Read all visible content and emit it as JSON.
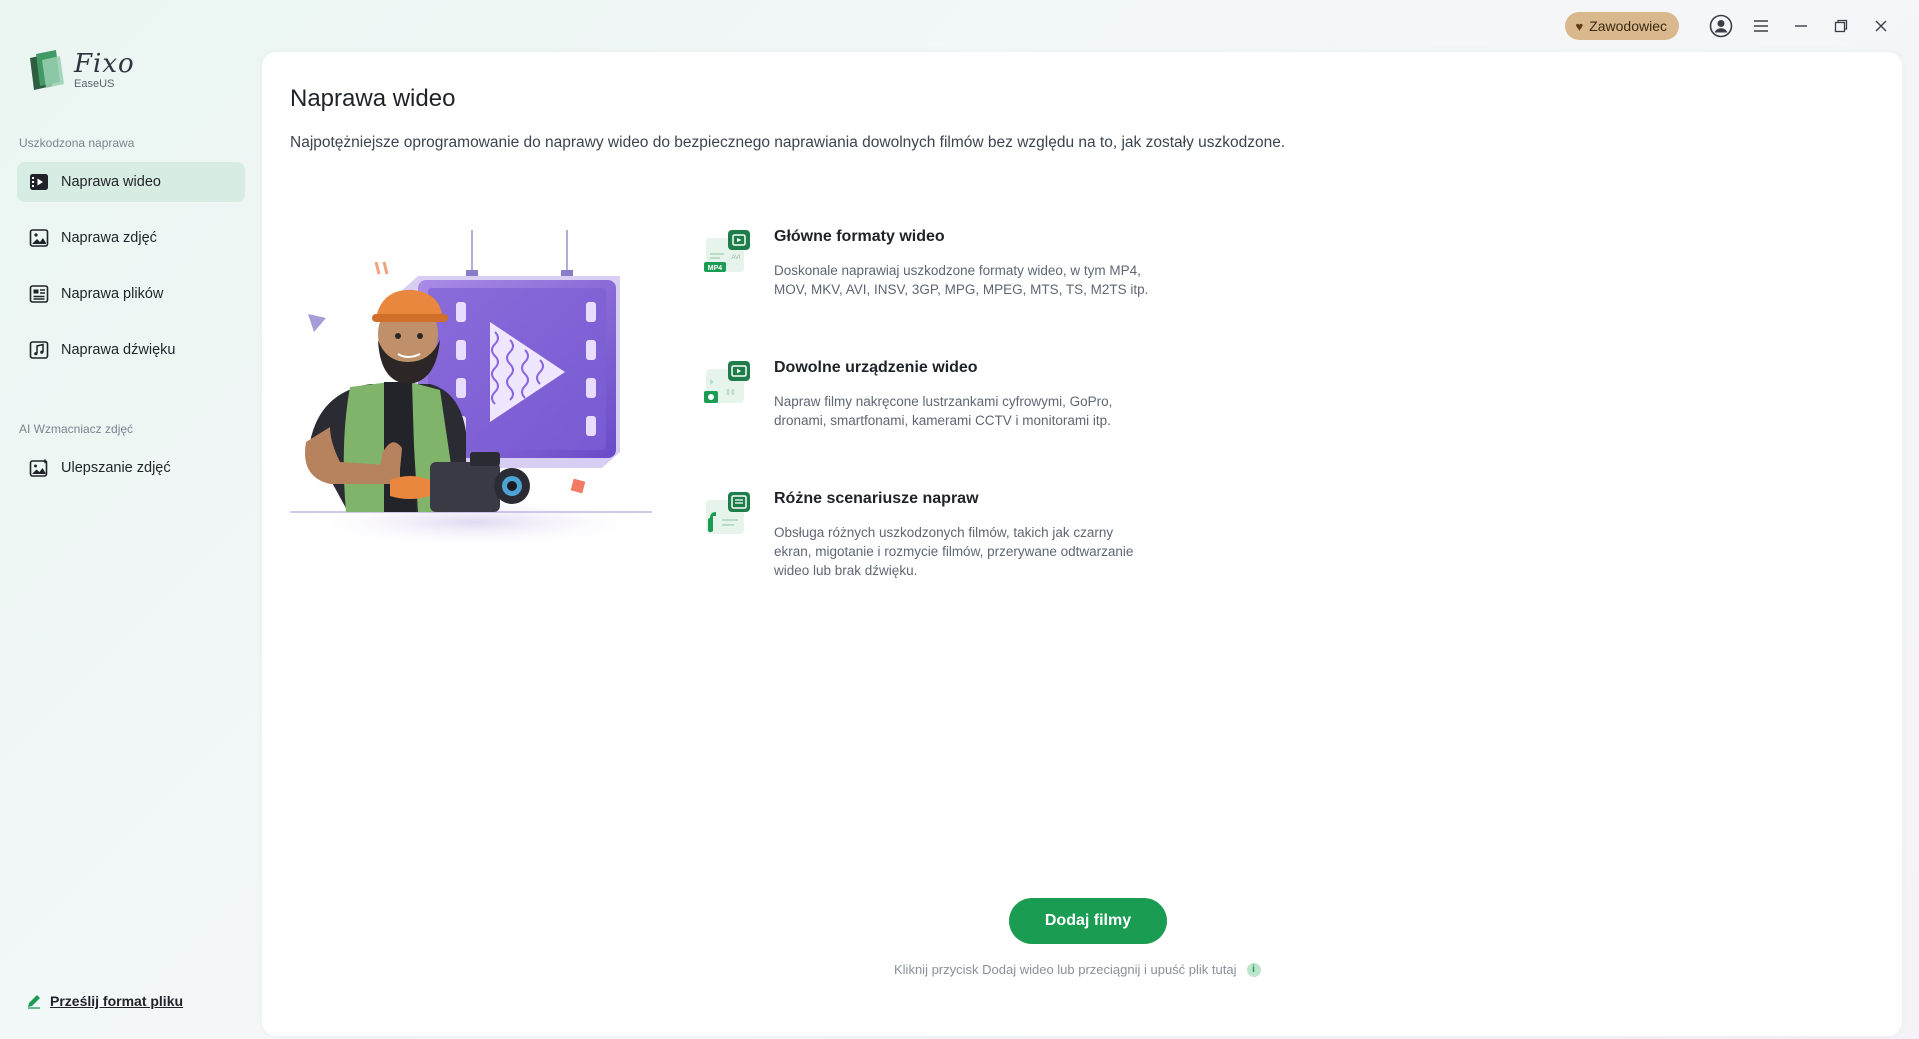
{
  "app": {
    "logo_name": "Fixo",
    "logo_sub": "EaseUS",
    "plan_badge": "Zawodowiec"
  },
  "sidebar": {
    "section1_label": "Uszkodzona naprawa",
    "items": [
      {
        "label": "Naprawa wideo",
        "icon": "video-icon",
        "active": true
      },
      {
        "label": "Naprawa zdjęć",
        "icon": "image-icon",
        "active": false
      },
      {
        "label": "Naprawa plików",
        "icon": "document-icon",
        "active": false
      },
      {
        "label": "Naprawa dźwięku",
        "icon": "music-icon",
        "active": false
      }
    ],
    "section2_label": "AI Wzmacniacz zdjęć",
    "enhance_item": {
      "label": "Ulepszanie zdjęć",
      "icon": "image-enhance-icon"
    },
    "upload_link": "Prześlij format pliku"
  },
  "main": {
    "title": "Naprawa wideo",
    "description": "Najpotężniejsze oprogramowanie do naprawy wideo do bezpiecznego naprawiania dowolnych filmów bez względu na to, jak zostały uszkodzone.",
    "features": [
      {
        "title": "Główne formaty wideo",
        "description": "Doskonale naprawiaj uszkodzone formaty wideo, w tym MP4, MOV, MKV, AVI, INSV, 3GP, MPG, MPEG, MTS, TS, M2TS itp.",
        "icon_labels": [
          "MP4",
          "AVI"
        ]
      },
      {
        "title": "Dowolne urządzenie wideo",
        "description": "Napraw filmy nakręcone lustrzankami cyfrowymi, GoPro, dronami, smartfonami, kamerami CCTV i monitorami itp."
      },
      {
        "title": "Różne scenariusze napraw",
        "description": "Obsługa różnych uszkodzonych filmów, takich jak czarny ekran, migotanie i rozmycie filmów, przerywane odtwarzanie wideo lub brak dźwięku."
      }
    ],
    "add_button": "Dodaj filmy",
    "hint": "Kliknij przycisk Dodaj wideo lub przeciągnij i upuść plik tutaj"
  },
  "colors": {
    "accent": "#1a9c53",
    "active_nav_bg": "#d7ece2",
    "badge_bg": "#d9b88e"
  }
}
